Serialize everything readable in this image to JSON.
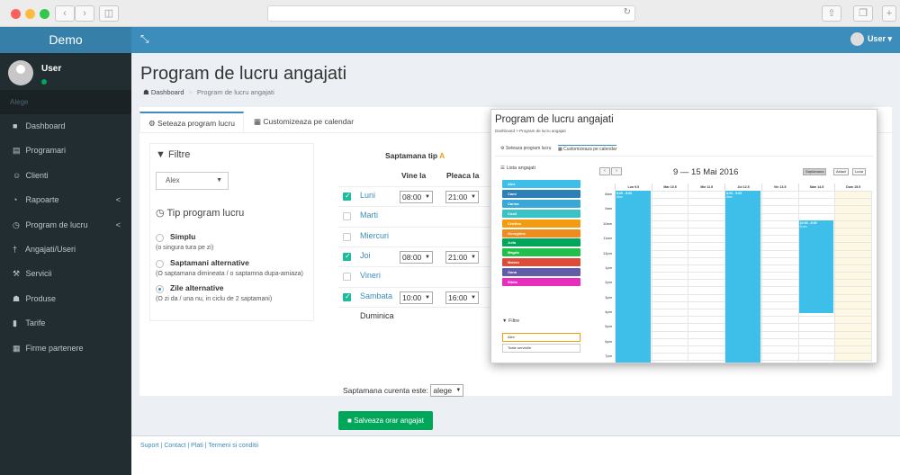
{
  "app": {
    "brand": "Demo",
    "user": "User",
    "alege": "Alege"
  },
  "menu": [
    {
      "label": "Dashboard",
      "icon": "dashboard-icon",
      "glyph": "■"
    },
    {
      "label": "Programari",
      "icon": "calendar-icon",
      "glyph": "▤"
    },
    {
      "label": "Clienti",
      "icon": "users-icon",
      "glyph": "☺"
    },
    {
      "label": "Rapoarte",
      "icon": "pie-chart-icon",
      "glyph": "◔",
      "caret": "<"
    },
    {
      "label": "Program de lucru",
      "icon": "clock-icon",
      "glyph": "◷",
      "caret": "<"
    },
    {
      "label": "Angajati/Useri",
      "icon": "user-icon",
      "glyph": "†"
    },
    {
      "label": "Servicii",
      "icon": "tools-icon",
      "glyph": "⚒"
    },
    {
      "label": "Produse",
      "icon": "cubes-icon",
      "glyph": "☗"
    },
    {
      "label": "Tarife",
      "icon": "book-icon",
      "glyph": "▮"
    },
    {
      "label": "Firme partenere",
      "icon": "building-icon",
      "glyph": "▦"
    }
  ],
  "page": {
    "title": "Program de lucru angajati",
    "breadcrumb_home": "Dashboard",
    "breadcrumb_current": "Program de lucru angajati"
  },
  "tabs": {
    "tab1": "Seteaza program lucru",
    "tab2": "Customizeaza pe calendar"
  },
  "filters": {
    "title": "Filtre",
    "employee": "Alex",
    "tip_title": "Tip program lucru",
    "options": [
      {
        "title": "Simplu",
        "desc": "(o singura tura pe zi)"
      },
      {
        "title": "Saptamani alternative",
        "desc": "(O saptamana dimineata / o saptamna dupa-amiaza)"
      },
      {
        "title": "Zile alternative",
        "desc": "(O zi da / una nu, in ciclu de 2 saptamani)"
      }
    ]
  },
  "schedule": {
    "week_label": "Saptamana tip",
    "week_letter": "A",
    "col_in": "Vine la",
    "col_out": "Pleaca la",
    "days": [
      {
        "name": "Luni",
        "checked": true,
        "in": "08:00",
        "out": "21:00"
      },
      {
        "name": "Marti",
        "checked": false,
        "in": "",
        "out": ""
      },
      {
        "name": "Miercuri",
        "checked": false,
        "in": "",
        "out": ""
      },
      {
        "name": "Joi",
        "checked": true,
        "in": "08:00",
        "out": "21:00"
      },
      {
        "name": "Vineri",
        "checked": false,
        "in": "",
        "out": ""
      },
      {
        "name": "Sambata",
        "checked": true,
        "in": "10:00",
        "out": "16:00"
      },
      {
        "name": "Duminica",
        "checked": false,
        "in": "",
        "out": ""
      }
    ],
    "current_week_label": "Saptamana curenta este:",
    "current_week_value": "alege"
  },
  "save_button": "Salveaza orar angajat",
  "footer": {
    "links": "Suport | Contact | Plati | Termeni si conditii"
  },
  "inset": {
    "title": "Program de lucru angajati",
    "breadcrumb": "Dashboard  >  Program de lucru angajati",
    "tab1": "Seteaza program lucru",
    "tab2": "Customizeaza pe calendar",
    "list_title": "Lista angajati",
    "employees": [
      {
        "name": "Alex",
        "color": "#3ebfea"
      },
      {
        "name": "Cami",
        "color": "#2d7fb8"
      },
      {
        "name": "Carina",
        "color": "#38a8d8"
      },
      {
        "name": "Costi",
        "color": "#3ac3c5"
      },
      {
        "name": "Cristina",
        "color": "#f39c12"
      },
      {
        "name": "Georgiana",
        "color": "#ee8c20"
      },
      {
        "name": "Julia",
        "color": "#00a65a"
      },
      {
        "name": "Magda",
        "color": "#20c04a"
      },
      {
        "name": "Marian",
        "color": "#dd4b39"
      },
      {
        "name": "Oana",
        "color": "#605ca8"
      },
      {
        "name": "Sibila",
        "color": "#e62dbd"
      }
    ],
    "filters_title": "Filtre",
    "filter1": "Alex",
    "filter2": "Toate serviciile",
    "range": "9 — 15 Mai 2016",
    "views": [
      "Saptamana",
      "Astazi",
      "Luna"
    ],
    "days": [
      "Lun 9.5",
      "Mar 10.5",
      "Mie 11.5",
      "Joi 12.5",
      "Vin 13.5",
      "Sâm 14.5",
      "Dum 15.5"
    ],
    "hours": [
      "8am",
      "9am",
      "10am",
      "11am",
      "12pm",
      "1pm",
      "2pm",
      "3pm",
      "4pm",
      "5pm",
      "6pm",
      "7pm"
    ],
    "events": [
      {
        "day": 0,
        "label": "8:00 - 9:00",
        "sub": "Alex",
        "start": 0,
        "end": 11.8
      },
      {
        "day": 3,
        "label": "8:00 - 9:00",
        "sub": "Alex",
        "start": 0,
        "end": 11.8
      },
      {
        "day": 5,
        "label": "10:00 - 8:00",
        "sub": "8 ore",
        "start": 2,
        "end": 8.3
      }
    ]
  }
}
